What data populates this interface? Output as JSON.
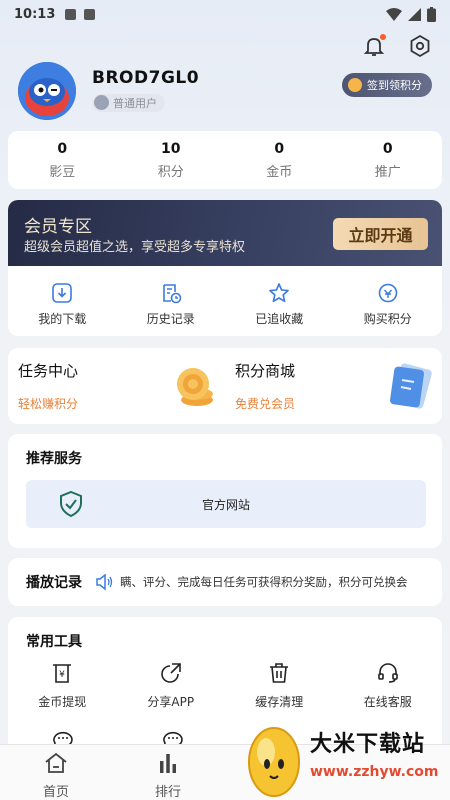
{
  "status_bar": {
    "time": "10:13"
  },
  "profile": {
    "name": "BROD7GL0",
    "level": "普通用户"
  },
  "signin": {
    "label": "签到领积分"
  },
  "stats": [
    {
      "value": "0",
      "label": "影豆"
    },
    {
      "value": "10",
      "label": "积分"
    },
    {
      "value": "0",
      "label": "金币"
    },
    {
      "value": "0",
      "label": "推广"
    }
  ],
  "vip": {
    "title": "会员专区",
    "subtitle": "超级会员超值之选，享受超多专享特权",
    "button": "立即开通"
  },
  "quick": [
    {
      "label": "我的下载",
      "icon": "download-icon"
    },
    {
      "label": "历史记录",
      "icon": "history-icon"
    },
    {
      "label": "已追收藏",
      "icon": "star-icon"
    },
    {
      "label": "购买积分",
      "icon": "points-icon"
    }
  ],
  "task": {
    "left": {
      "title": "任务中心",
      "sub": "轻松赚积分"
    },
    "right": {
      "title": "积分商城",
      "sub": "免费兑会员"
    }
  },
  "recommend": {
    "title": "推荐服务",
    "site_label": "官方网站"
  },
  "play": {
    "title": "播放记录",
    "marquee": "瞒、评分、完成每日任务可获得积分奖励，积分可兑换会"
  },
  "tools": {
    "title": "常用工具",
    "items": [
      {
        "label": "金币提现",
        "icon": "withdraw-icon"
      },
      {
        "label": "分享APP",
        "icon": "share-icon"
      },
      {
        "label": "缓存清理",
        "icon": "trash-icon"
      },
      {
        "label": "在线客服",
        "icon": "headset-icon"
      }
    ]
  },
  "tabbar": [
    {
      "label": "首页",
      "icon": "home-icon"
    },
    {
      "label": "排行",
      "icon": "ranking-icon"
    }
  ],
  "watermark": {
    "title": "大米下载站",
    "url": "www.zzhyw.com"
  },
  "colors": {
    "accent": "#2f6fe0",
    "orange": "#e8823b",
    "vip_dark": "#252b45",
    "gold": "#e7c394"
  }
}
